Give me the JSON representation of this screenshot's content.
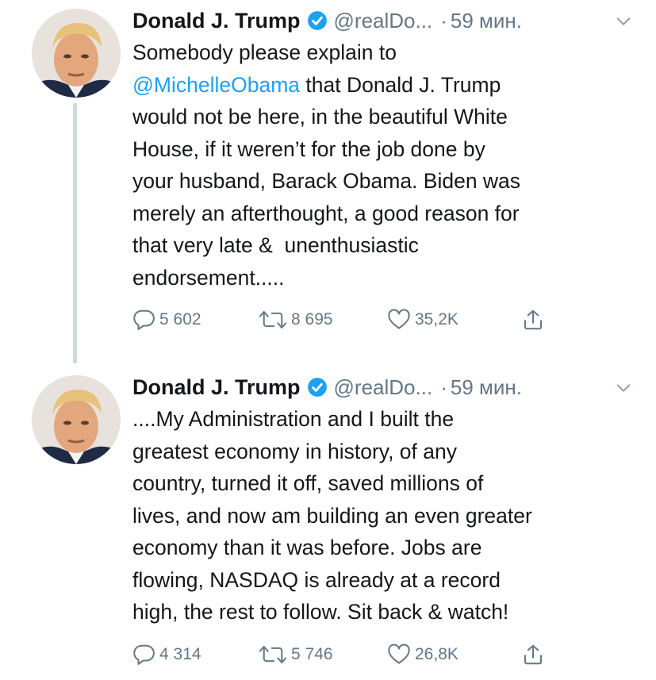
{
  "colors": {
    "accent": "#1da1f2",
    "text": "#14171a",
    "muted": "#657786",
    "verified": "#1da1f2",
    "thread_line": "#cfd9de"
  },
  "tweets": [
    {
      "author": {
        "name": "Donald J. Trump",
        "handle": "@realDo...",
        "verified": true
      },
      "separator": "·",
      "time": "59 мин.",
      "text_prefix": "Somebody please explain to\n",
      "mention": "@MichelleObama",
      "text_suffix": " that Donald J. Trump\nwould not be here, in the beautiful White\nHouse, if it weren’t for the job done by\nyour husband, Barack Obama. Biden was\nmerely an afterthought, a good reason for\nthat very late &  unenthusiastic\nendorsement.....",
      "stats": {
        "replies": "5 602",
        "retweets": "8 695",
        "likes": "35,2K"
      },
      "icons": [
        "reply-icon",
        "retweet-icon",
        "like-icon",
        "share-icon"
      ]
    },
    {
      "author": {
        "name": "Donald J. Trump",
        "handle": "@realDo...",
        "verified": true
      },
      "separator": "·",
      "time": "59 мин.",
      "text": "....My Administration and I built the\ngreatest economy in history, of any\ncountry, turned it off, saved millions of\nlives, and now am building an even greater\neconomy than it was before. Jobs are\nflowing, NASDAQ is already at a record\nhigh, the rest to follow. Sit back & watch!",
      "stats": {
        "replies": "4 314",
        "retweets": "5 746",
        "likes": "26,8K"
      },
      "icons": [
        "reply-icon",
        "retweet-icon",
        "like-icon",
        "share-icon"
      ]
    }
  ]
}
